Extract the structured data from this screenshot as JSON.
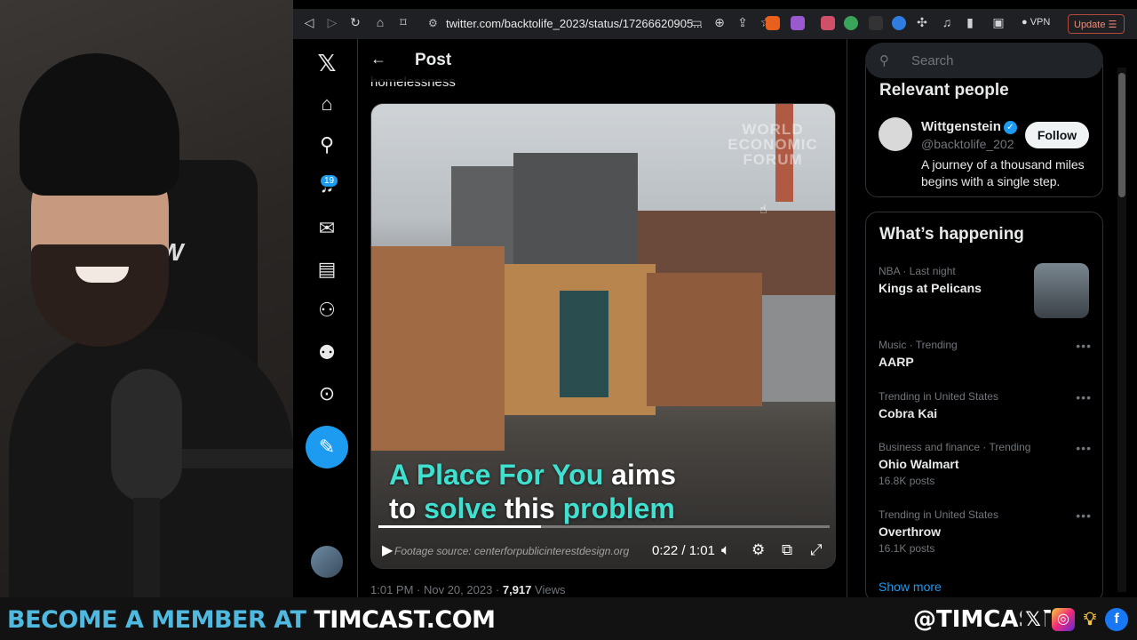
{
  "browser": {
    "url": "twitter.com/backtolife_2023/status/17266620905...",
    "vpn_label": "VPN",
    "update_label": "Update"
  },
  "nav": {
    "notifications_count": "19"
  },
  "post": {
    "header_title": "Post",
    "text_fragment": "homelessness",
    "video": {
      "watermark": "WORLD ECONOMIC FORUM",
      "caption_line1_a": "A Place For You",
      "caption_line1_b": " aims",
      "caption_line2_a": "to ",
      "caption_line2_b": "solve",
      "caption_line2_c": " this ",
      "caption_line2_d": "problem",
      "footage_source": "Footage source: centerforpublicinterestdesign.org",
      "time": "0:22 / 1:01",
      "progress": 0.36
    },
    "meta_time": "1:01 PM · Nov 20, 2023 · ",
    "meta_views_count": "7,917",
    "meta_views_label": " Views"
  },
  "sidebar": {
    "search_placeholder": "Search",
    "relevant_people": {
      "title": "Relevant people",
      "name": "Wittgenstein",
      "handle": "@backtolife_202",
      "follow_label": "Follow",
      "bio": "A journey of a thousand miles begins with a single step."
    },
    "whats_happening": {
      "title": "What’s happening",
      "trends": [
        {
          "category": "NBA · Last night",
          "title": "Kings at Pelicans",
          "count": ""
        },
        {
          "category": "Music · Trending",
          "title": "AARP",
          "count": ""
        },
        {
          "category": "Trending in United States",
          "title": "Cobra Kai",
          "count": ""
        },
        {
          "category": "Business and finance · Trending",
          "title": "Ohio Walmart",
          "count": "16.8K posts"
        },
        {
          "category": "Trending in United States",
          "title": "Overthrow",
          "count": "16.1K posts"
        }
      ],
      "show_more": "Show more"
    }
  },
  "banner": {
    "left_a": "BECOME A MEMBER AT ",
    "left_b": "TIMCAST.COM",
    "right": "@TIMCAST"
  },
  "colors": {
    "accent": "#1d9bf0",
    "caption_highlight": "#40e0d0",
    "banner_blue": "#4fb9e0"
  }
}
